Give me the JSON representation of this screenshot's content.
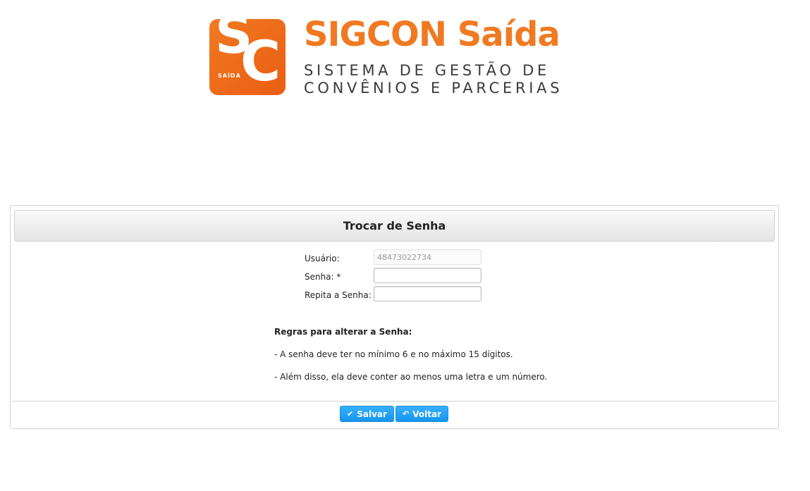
{
  "header": {
    "badge_s": "S",
    "badge_c": "C",
    "badge_text": "SAÍDA",
    "brand_title": "SIGCON Saída",
    "brand_sub_line1": "SISTEMA DE GESTÃO DE",
    "brand_sub_line2": "CONVÊNIOS E PARCERIAS",
    "brand_color": "#f07a22"
  },
  "panel": {
    "title": "Trocar de Senha"
  },
  "form": {
    "user_label": "Usuário:",
    "user_value": "48473022734",
    "password_label": "Senha: *",
    "password_value": "",
    "repeat_label": "Repita a Senha: *",
    "repeat_value": ""
  },
  "rules": {
    "title": "Regras para alterar a Senha:",
    "rule1": "- A senha deve ter no mínimo 6 e no máximo 15 dígitos.",
    "rule2": "- Além disso, ela deve conter ao menos uma letra e um número."
  },
  "buttons": {
    "save_label": "Salvar",
    "save_icon": "check-icon",
    "back_label": "Voltar",
    "back_icon": "undo-arrow-icon",
    "button_color": "#1e96f0"
  }
}
